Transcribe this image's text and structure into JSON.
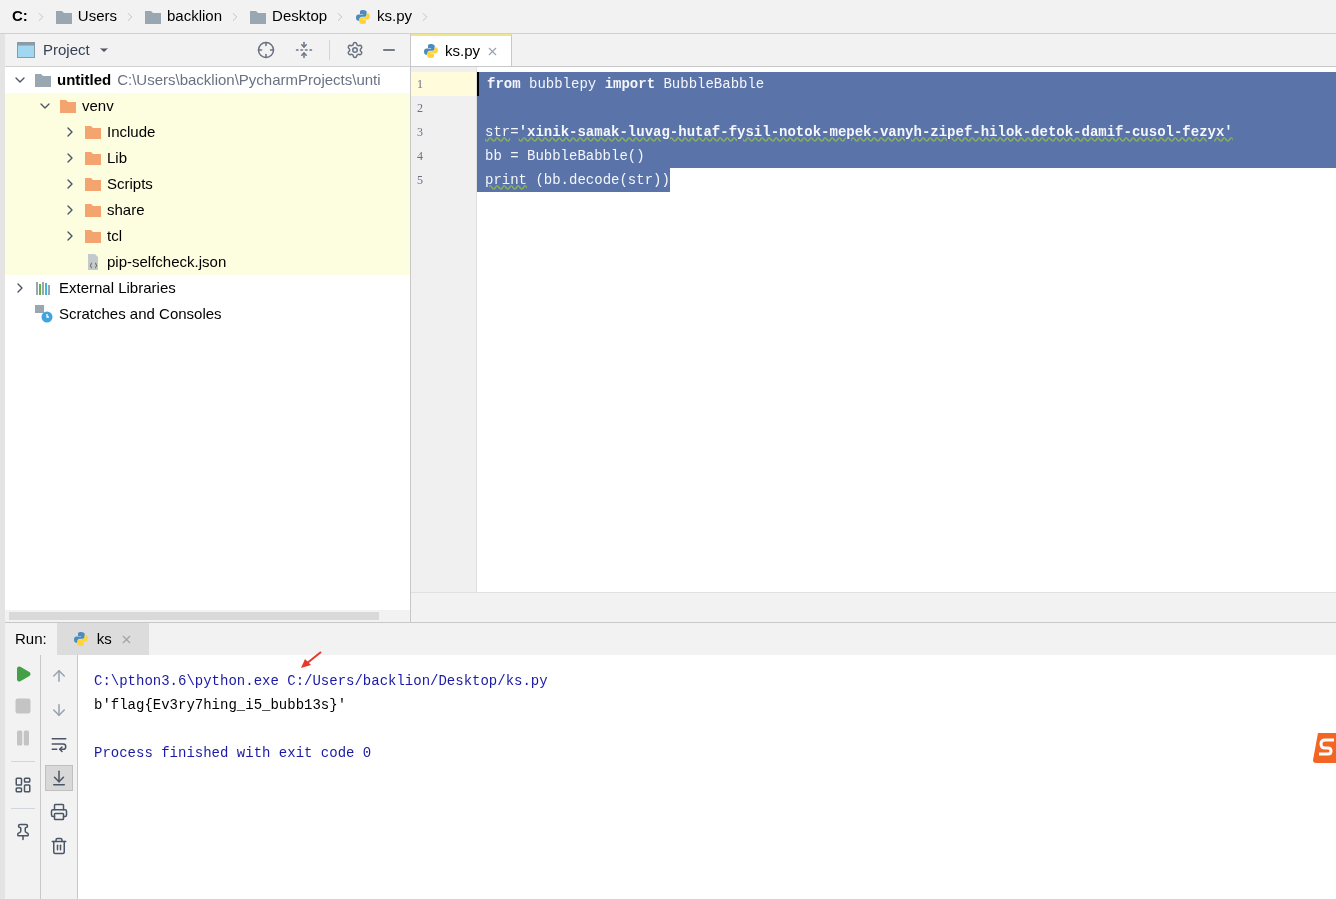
{
  "breadcrumb": [
    {
      "kind": "drive",
      "label": "C:"
    },
    {
      "kind": "folder",
      "label": "Users"
    },
    {
      "kind": "folder",
      "label": "backlion"
    },
    {
      "kind": "folder",
      "label": "Desktop"
    },
    {
      "kind": "python",
      "label": "ks.py"
    }
  ],
  "project_panel": {
    "title": "Project",
    "tree": [
      {
        "kind": "root",
        "label": "untitled",
        "path": "C:\\Users\\backlion\\PycharmProjects\\unti",
        "expanded": true,
        "highlighted": false,
        "children": [
          {
            "kind": "folder",
            "label": "venv",
            "expanded": true,
            "highlighted": true,
            "children": [
              {
                "kind": "folder",
                "label": "Include",
                "expanded": false,
                "highlighted": true
              },
              {
                "kind": "folder",
                "label": "Lib",
                "expanded": false,
                "highlighted": true
              },
              {
                "kind": "folder",
                "label": "Scripts",
                "expanded": false,
                "highlighted": true
              },
              {
                "kind": "folder",
                "label": "share",
                "expanded": false,
                "highlighted": true
              },
              {
                "kind": "folder",
                "label": "tcl",
                "expanded": false,
                "highlighted": true
              },
              {
                "kind": "json",
                "label": "pip-selfcheck.json",
                "highlighted": true
              }
            ]
          }
        ]
      },
      {
        "kind": "libraries",
        "label": "External Libraries",
        "expanded": false,
        "highlighted": false
      },
      {
        "kind": "scratches",
        "label": "Scratches and Consoles",
        "highlighted": false
      }
    ]
  },
  "editor": {
    "tabs": [
      {
        "label": "ks.py",
        "selected": true
      }
    ],
    "lines": [
      {
        "number": "1",
        "current": true,
        "full_width": true,
        "tokens": [
          {
            "text": "from",
            "bold": true,
            "underline": false
          },
          {
            "text": " bubblepy ",
            "bold": false,
            "underline": false
          },
          {
            "text": "import",
            "bold": true,
            "underline": false
          },
          {
            "text": " BubbleBabble",
            "bold": false,
            "underline": false
          }
        ]
      },
      {
        "number": "2",
        "current": false,
        "full_width": true
      },
      {
        "number": "3",
        "current": false,
        "full_width": true,
        "tokens": [
          {
            "text": "str",
            "bold": false,
            "underline": true
          },
          {
            "text": "=",
            "bold": false,
            "underline": false
          },
          {
            "text": "'xinik-samak-luvag-hutaf-fysil-notok-mepek-vanyh-zipef-hilok-detok-damif-cusol-fezyx'",
            "bold": true,
            "underline": true
          }
        ]
      },
      {
        "number": "4",
        "current": false,
        "full_width": true,
        "tokens": [
          {
            "text": "bb = BubbleBabble()",
            "bold": false,
            "underline": false
          }
        ]
      },
      {
        "number": "5",
        "current": false,
        "full_width": false,
        "tokens": [
          {
            "text": "print",
            "bold": false,
            "underline": true
          },
          {
            "text": " (bb.decode(str))",
            "bold": false,
            "underline": false
          }
        ]
      }
    ]
  },
  "run_panel": {
    "label": "Run:",
    "tabs": [
      {
        "label": "ks",
        "selected": true
      }
    ],
    "toolbar_left": [
      {
        "kind": "run",
        "disabled": false
      },
      {
        "kind": "stop",
        "disabled": true
      },
      {
        "kind": "pause",
        "disabled": true
      },
      {
        "kind": "layout",
        "disabled": false
      },
      {
        "kind": "pin",
        "disabled": false
      }
    ],
    "toolbar_right": [
      {
        "kind": "up",
        "selected": false
      },
      {
        "kind": "down",
        "selected": false
      },
      {
        "kind": "wrap",
        "selected": false
      },
      {
        "kind": "scroll-end",
        "selected": true
      },
      {
        "kind": "print",
        "selected": false
      },
      {
        "kind": "trash",
        "selected": false
      }
    ],
    "output": [
      {
        "kind": "system",
        "text": "C:\\pthon3.6\\python.exe C:/Users/backlion/Desktop/ks.py"
      },
      {
        "kind": "stdout",
        "text": "b'flag{Ev3ry7hing_i5_bubb13s}'"
      },
      {
        "kind": "system",
        "text": "Process finished with exit code 0"
      }
    ]
  }
}
